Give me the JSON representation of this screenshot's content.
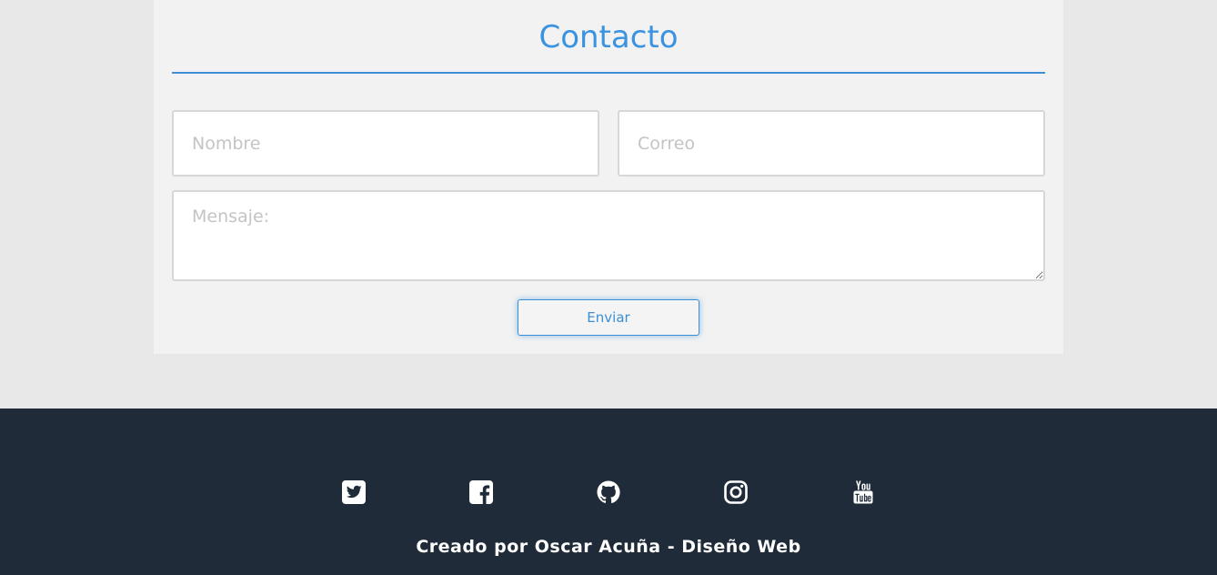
{
  "contact": {
    "title": "Contacto",
    "name_placeholder": "Nombre",
    "email_placeholder": "Correo",
    "message_placeholder": "Mensaje:",
    "submit_label": "Enviar"
  },
  "footer": {
    "social": [
      {
        "icon": "twitter-icon"
      },
      {
        "icon": "facebook-icon"
      },
      {
        "icon": "github-icon"
      },
      {
        "icon": "instagram-icon"
      },
      {
        "icon": "youtube-icon"
      }
    ],
    "credits": "Creado por Oscar Acuña - Diseño Web"
  },
  "colors": {
    "accent": "#3a93e0",
    "page_background": "#e8e8e8",
    "card_background": "#f2f2f2",
    "footer_background": "#1f2b38"
  }
}
